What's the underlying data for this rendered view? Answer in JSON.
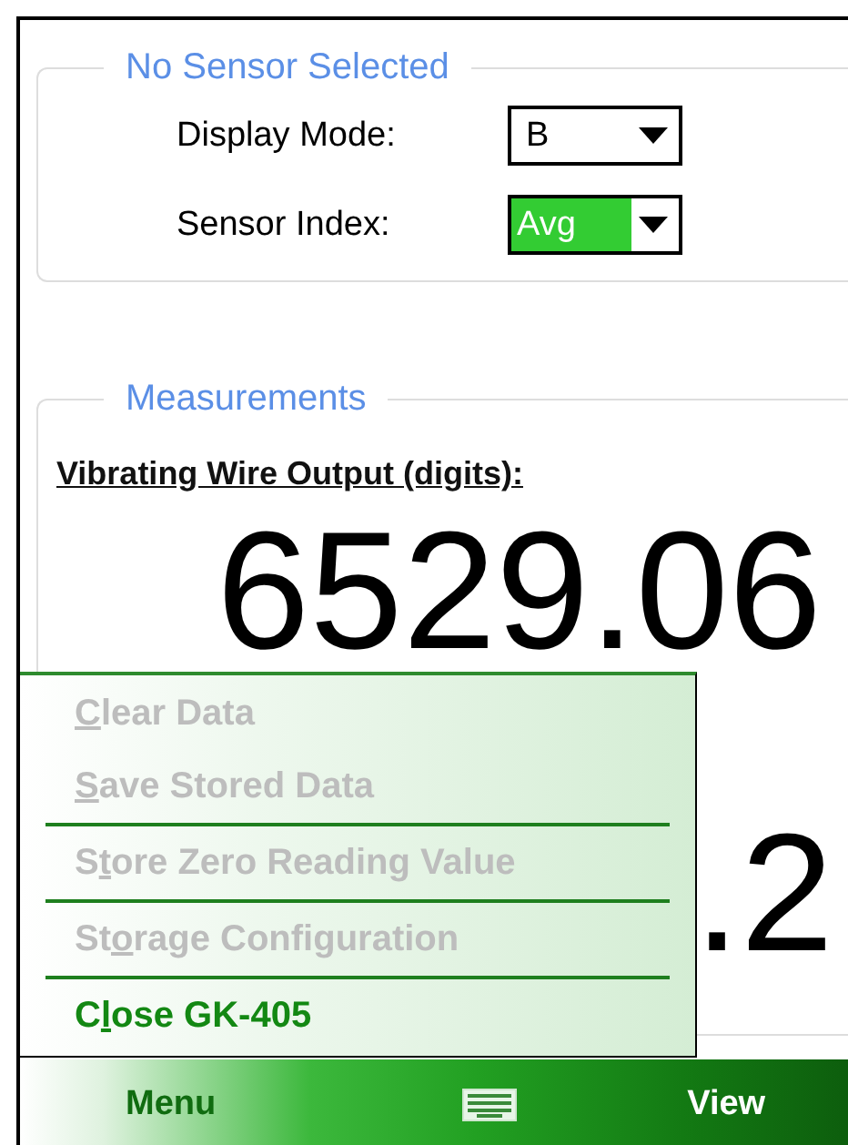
{
  "sensor_panel": {
    "title": "No Sensor Selected",
    "fields": [
      {
        "label": "Display Mode:",
        "value": "B",
        "highlighted": false
      },
      {
        "label": "Sensor Index:",
        "value": "Avg",
        "highlighted": true
      }
    ]
  },
  "measurements_panel": {
    "title": "Measurements",
    "heading": "Vibrating Wire Output (digits):",
    "readings": [
      "6529.06",
      ".2"
    ]
  },
  "menu": {
    "items": [
      {
        "mnemonic": "C",
        "rest": "lear Data",
        "disabled": true,
        "separator_before": false
      },
      {
        "mnemonic": "S",
        "rest": "ave Stored Data",
        "disabled": true,
        "separator_before": false
      },
      {
        "prefix": "S",
        "mnemonic": "t",
        "rest": "ore Zero Reading Value",
        "disabled": true,
        "separator_before": true
      },
      {
        "prefix": "St",
        "mnemonic": "o",
        "rest": "rage Configuration",
        "disabled": true,
        "separator_before": true
      },
      {
        "prefix": "C",
        "mnemonic": "l",
        "rest": "ose GK-405",
        "disabled": false,
        "separator_before": true
      }
    ]
  },
  "softkeys": {
    "left": "Menu",
    "right": "View"
  }
}
